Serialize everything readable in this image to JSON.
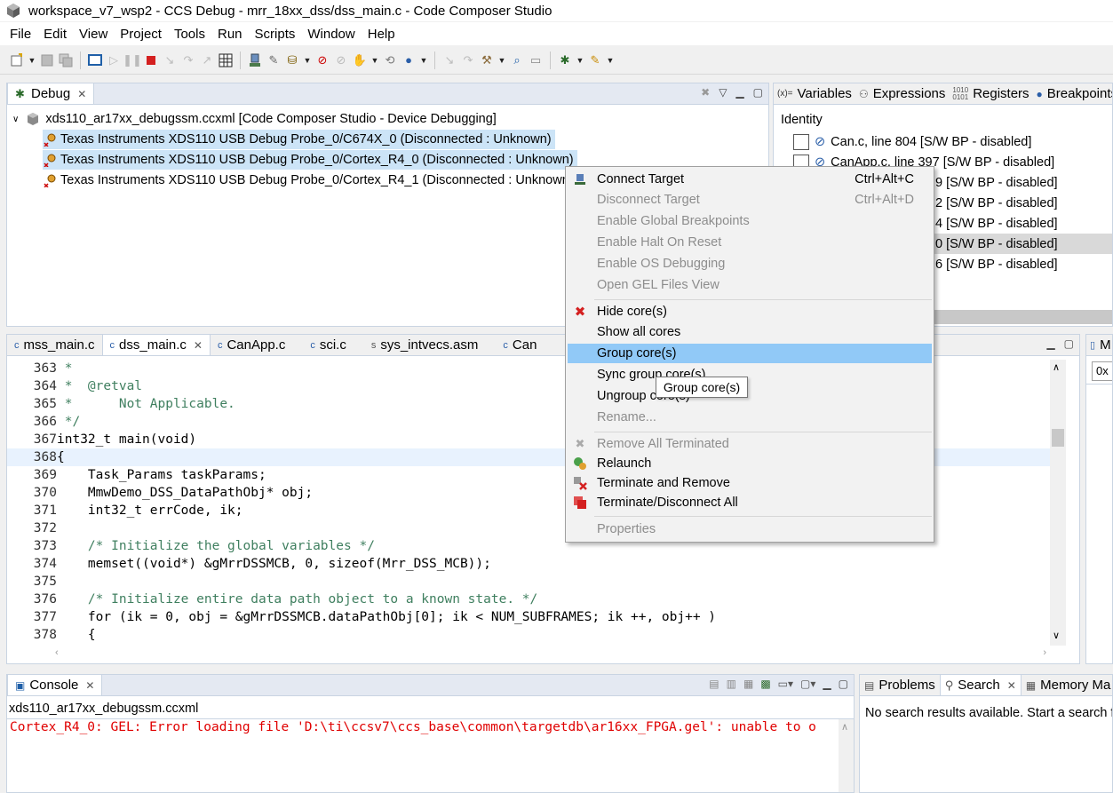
{
  "window": {
    "title": "workspace_v7_wsp2 - CCS Debug - mrr_18xx_dss/dss_main.c - Code Composer Studio"
  },
  "menu": [
    "File",
    "Edit",
    "View",
    "Project",
    "Tools",
    "Run",
    "Scripts",
    "Window",
    "Help"
  ],
  "debug_view": {
    "tab_label": "Debug",
    "root": "xds110_ar17xx_debugssm.ccxml [Code Composer Studio - Device Debugging]",
    "cores": [
      {
        "label": "Texas Instruments XDS110 USB Debug Probe_0/C674X_0 (Disconnected : Unknown)",
        "selected": true
      },
      {
        "label": "Texas Instruments XDS110 USB Debug Probe_0/Cortex_R4_0 (Disconnected : Unknown)",
        "selected": true
      },
      {
        "label": "Texas Instruments XDS110 USB Debug Probe_0/Cortex_R4_1 (Disconnected : Unknown)",
        "selected": false
      }
    ]
  },
  "right_panel": {
    "tabs": [
      "Variables",
      "Expressions",
      "Registers",
      "Breakpoints"
    ],
    "icons": [
      "variables-icon",
      "expressions-icon",
      "registers-icon",
      "breakpoints-icon"
    ],
    "tab_prefix": "(x)=",
    "column": "Identity",
    "breakpoints": [
      "Can.c, line 804 [S/W BP - disabled]",
      "CanApp.c, line 397 [S/W BP - disabled]",
      "9 [S/W BP - disabled]",
      "2 [S/W BP - disabled]",
      "4 [S/W BP - disabled]",
      "0 [S/W BP - disabled]",
      "6 [S/W BP - disabled]"
    ]
  },
  "editor": {
    "tabs": [
      "mss_main.c",
      "dss_main.c",
      "CanApp.c",
      "sci.c",
      "sys_intvecs.asm",
      "Can"
    ],
    "active_tab": 1,
    "lines": [
      {
        "n": "363",
        "t": " *"
      },
      {
        "n": "364",
        "t": " *  @retval"
      },
      {
        "n": "365",
        "t": " *      Not Applicable."
      },
      {
        "n": "366",
        "t": " */"
      },
      {
        "n": "367",
        "t": "int32_t main(void)"
      },
      {
        "n": "368",
        "t": "{"
      },
      {
        "n": "369",
        "t": "    Task_Params taskParams;"
      },
      {
        "n": "370",
        "t": "    MmwDemo_DSS_DataPathObj* obj;"
      },
      {
        "n": "371",
        "t": "    int32_t errCode, ik;"
      },
      {
        "n": "372",
        "t": ""
      },
      {
        "n": "373",
        "t": "    /* Initialize the global variables */"
      },
      {
        "n": "374",
        "t": "    memset((void*) &gMrrDSSMCB, 0, sizeof(Mrr_DSS_MCB));"
      },
      {
        "n": "375",
        "t": ""
      },
      {
        "n": "376",
        "t": "    /* Initialize entire data path object to a known state. */"
      },
      {
        "n": "377",
        "t": "    for (ik = 0, obj = &gMrrDSSMCB.dataPathObj[0]; ik < NUM_SUBFRAMES; ik ++, obj++ )"
      },
      {
        "n": "378",
        "t": "    {"
      }
    ]
  },
  "side_panel_right": {
    "tab_label": "M",
    "field_value": "0x"
  },
  "context_menu": {
    "items": [
      {
        "label": "Connect Target",
        "accel": "Ctrl+Alt+C",
        "disabled": false,
        "icon": "connect-target-icon"
      },
      {
        "label": "Disconnect Target",
        "accel": "Ctrl+Alt+D",
        "disabled": true
      },
      {
        "label": "Enable Global Breakpoints",
        "disabled": true
      },
      {
        "label": "Enable Halt On Reset",
        "disabled": true
      },
      {
        "label": "Enable OS Debugging",
        "disabled": true
      },
      {
        "label": "Open GEL Files View",
        "disabled": true
      },
      {
        "label": "Hide core(s)",
        "disabled": false,
        "icon": "hide-core-icon"
      },
      {
        "label": "Show all cores",
        "disabled": false
      },
      {
        "label": "Group core(s)",
        "disabled": false,
        "highlighted": true
      },
      {
        "label": "Sync group core(s)",
        "disabled": false
      },
      {
        "label": "Ungroup core(s)",
        "disabled": false
      },
      {
        "label": "Rename...",
        "disabled": true
      },
      {
        "label": "Remove All Terminated",
        "disabled": true,
        "icon": "remove-terminated-icon"
      },
      {
        "label": "Relaunch",
        "disabled": false,
        "icon": "relaunch-icon"
      },
      {
        "label": "Terminate and Remove",
        "disabled": false,
        "icon": "terminate-remove-icon"
      },
      {
        "label": "Terminate/Disconnect All",
        "disabled": false,
        "icon": "terminate-all-icon"
      },
      {
        "label": "Properties",
        "disabled": true
      }
    ],
    "tooltip": "Group core(s)"
  },
  "console": {
    "tab_label": "Console",
    "subtitle": "xds110_ar17xx_debugssm.ccxml",
    "error_line": "Cortex_R4_0: GEL: Error loading file 'D:\\ti\\ccsv7\\ccs_base\\common\\targetdb\\ar16xx_FPGA.gel': unable to o"
  },
  "bottom_right": {
    "tabs": [
      "Problems",
      "Search",
      "Memory Ma"
    ],
    "message": "No search results available. Start a search f"
  }
}
